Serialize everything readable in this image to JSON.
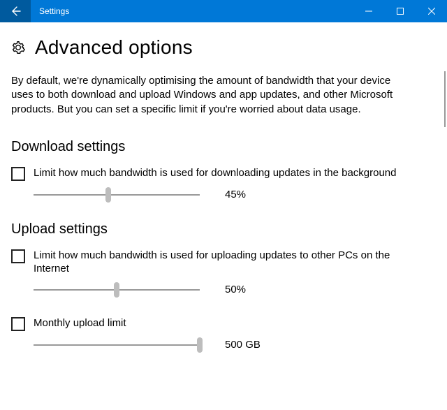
{
  "window": {
    "title": "Settings"
  },
  "page": {
    "heading": "Advanced options",
    "intro": "By default, we're dynamically optimising the amount of bandwidth that your device uses to both download and upload Windows and app updates, and other Microsoft products. But you can set a specific limit if you're worried about data usage."
  },
  "download": {
    "heading": "Download settings",
    "limit_label": "Limit how much bandwidth is used for downloading updates in the background",
    "limit_checked": false,
    "percent_value": 45,
    "percent_display": "45%"
  },
  "upload": {
    "heading": "Upload settings",
    "limit_label": "Limit how much bandwidth is used for uploading updates to other PCs on the Internet",
    "limit_checked": false,
    "percent_value": 50,
    "percent_display": "50%",
    "monthly_label": "Monthly upload limit",
    "monthly_checked": false,
    "monthly_value": 500,
    "monthly_max": 500,
    "monthly_display": "500 GB"
  }
}
